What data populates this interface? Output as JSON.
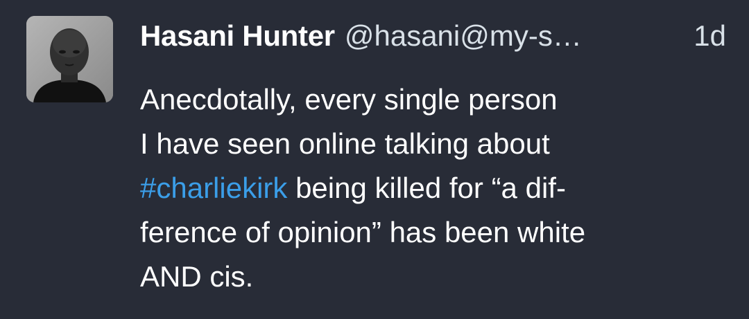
{
  "post": {
    "author": {
      "display_name": "Hasani Hunter",
      "handle": "@hasani@my-s…"
    },
    "timestamp": "1d",
    "content": {
      "line1": "Anecdotally, every single person",
      "line2": "I have seen online talking about",
      "hashtag": "#charliekirk",
      "line3_rest": " being killed for “a dif-",
      "line4": "ference of opinion” has been white",
      "line5": "AND cis."
    }
  },
  "colors": {
    "background": "#282c37",
    "text": "#ffffff",
    "secondary_text": "#d9e1e8",
    "hashtag": "#3b9ee8"
  }
}
